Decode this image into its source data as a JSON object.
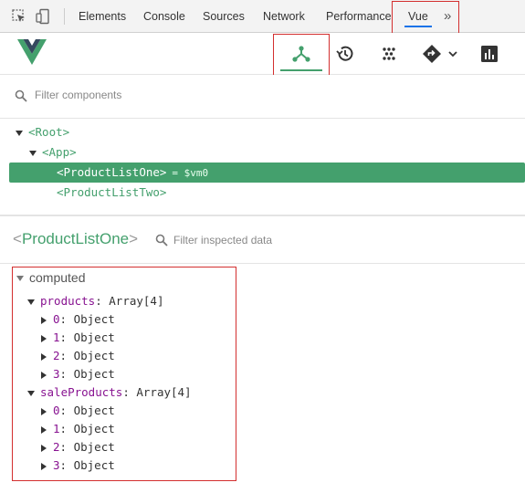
{
  "devtools": {
    "tabs": [
      "Elements",
      "Console",
      "Sources",
      "Network",
      "Performance",
      "Vue"
    ],
    "more": "»"
  },
  "colors": {
    "vue_green": "#44a06d",
    "highlight_red": "#d32f2f",
    "key_purple": "#881391"
  },
  "vue_toolbar": {
    "buttons": [
      "components-icon",
      "history-icon",
      "vuex-icon",
      "routing-icon",
      "performance-icon"
    ]
  },
  "component_filter": {
    "placeholder": "Filter components"
  },
  "tree": {
    "root": "Root",
    "app": "App",
    "selected": "ProductListOne",
    "selected_ref": "= $vm0",
    "sibling": "ProductListTwo"
  },
  "inspector": {
    "component": "ProductListOne",
    "filter_placeholder": "Filter inspected data",
    "section": "computed",
    "properties": [
      {
        "key": "products",
        "value": "Array[4]",
        "items": [
          "0",
          "1",
          "2",
          "3"
        ],
        "item_value": "Object"
      },
      {
        "key": "saleProducts",
        "value": "Array[4]",
        "items": [
          "0",
          "1",
          "2",
          "3"
        ],
        "item_value": "Object"
      }
    ]
  }
}
